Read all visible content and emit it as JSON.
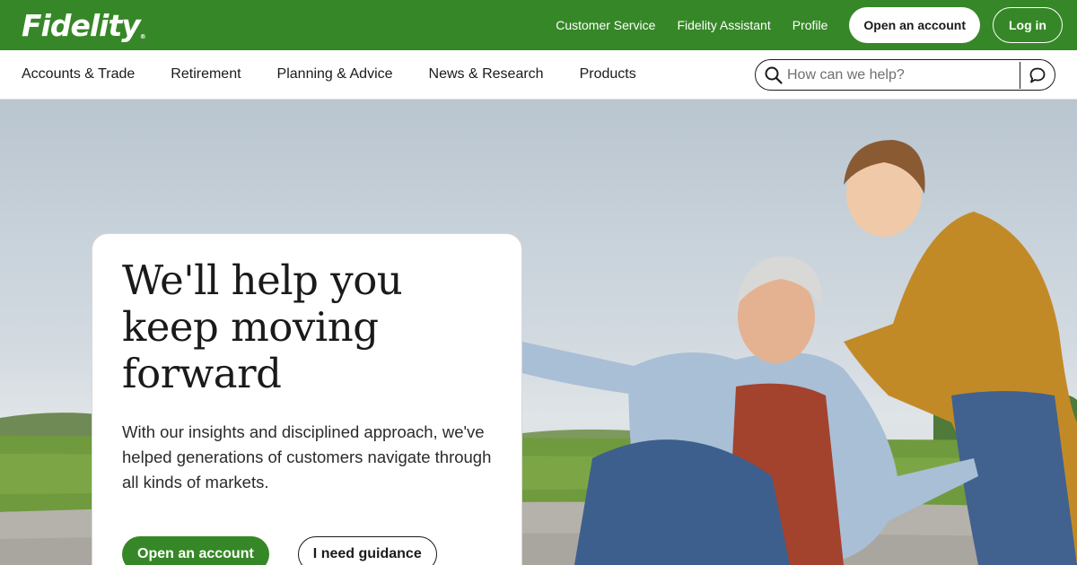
{
  "brand": {
    "logo_text": "Fidelity",
    "trademark": "®",
    "color": "#368727"
  },
  "utility_nav": {
    "links": [
      "Customer Service",
      "Fidelity Assistant",
      "Profile"
    ],
    "open_account_label": "Open an account",
    "login_label": "Log in"
  },
  "main_nav": {
    "items": [
      "Accounts & Trade",
      "Retirement",
      "Planning & Advice",
      "News & Research",
      "Products"
    ]
  },
  "search": {
    "placeholder": "How can we help?",
    "icon": "search-icon",
    "chat_icon": "chat-icon"
  },
  "hero": {
    "headline": "We'll help you keep moving forward",
    "subtext": "With our insights and disciplined approach, we've helped generations of customers navigate through all kinds of markets.",
    "primary_button": "Open an account",
    "secondary_button": "I need guidance"
  }
}
